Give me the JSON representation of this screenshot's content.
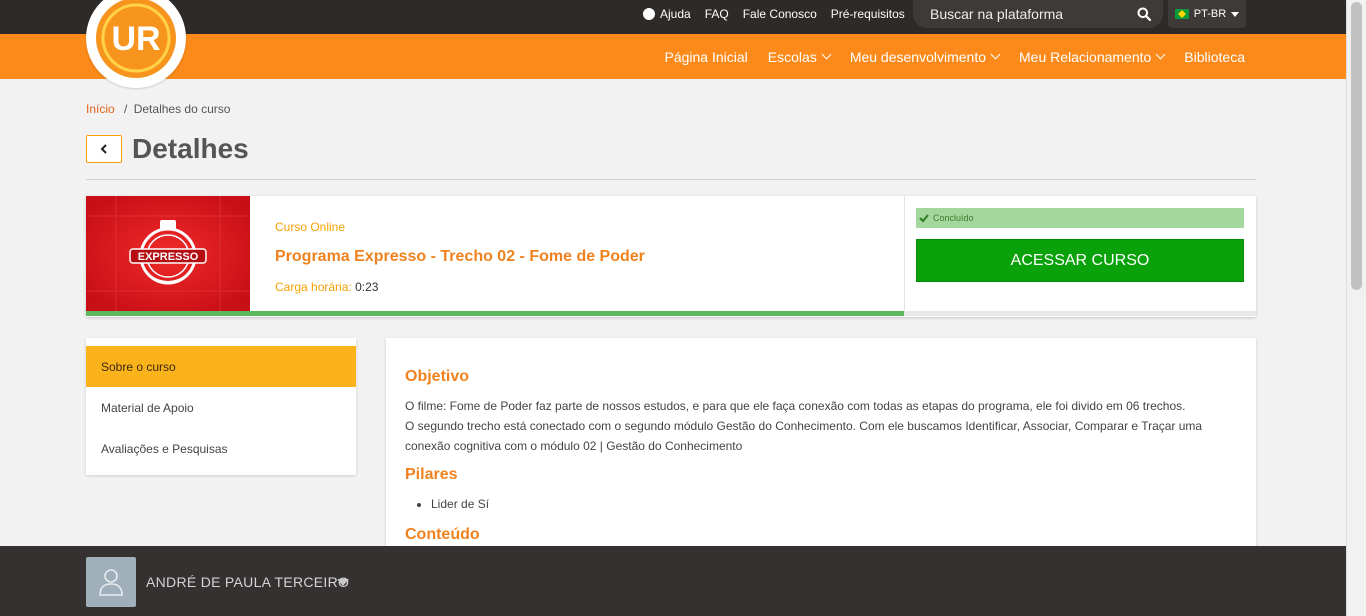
{
  "topbar": {
    "links": [
      "Ajuda",
      "FAQ",
      "Fale Conosco",
      "Pré-requisitos"
    ],
    "search_placeholder": "Buscar na plataforma",
    "language": "PT-BR"
  },
  "logo": {
    "text": "UR"
  },
  "nav": {
    "items": [
      {
        "label": "Página Inicial"
      },
      {
        "label": "Escolas"
      },
      {
        "label": "Meu desenvolvimento"
      },
      {
        "label": "Meu Relacionamento"
      },
      {
        "label": "Biblioteca"
      }
    ]
  },
  "breadcrumb": {
    "home": "Início",
    "separator": "/",
    "current": "Detalhes do curso"
  },
  "page": {
    "title": "Detalhes"
  },
  "course": {
    "type": "Curso Online",
    "title": "Programa Expresso - Trecho 02 - Fome de Poder",
    "workload_label": "Carga horária:",
    "workload_value": "0:23",
    "status": "Concluído",
    "access_button": "ACESSAR CURSO",
    "thumbnail_text": "EXPRESSO",
    "progress": 1.0
  },
  "sidebar": {
    "items": [
      {
        "label": "Sobre o curso",
        "active": true
      },
      {
        "label": "Material de Apoio",
        "active": false
      },
      {
        "label": "Avaliações e Pesquisas",
        "active": false
      }
    ]
  },
  "content": {
    "objective_heading": "Objetivo",
    "objective_p1": "O filme: Fome de Poder faz parte de nossos estudos, e para que ele faça conexão com todas as etapas do programa, ele foi divido em 06 trechos.",
    "objective_p2": "O segundo trecho está conectado com o segundo módulo Gestão do Conhecimento. Com ele buscamos Identificar, Associar, Comparar e Traçar uma conexão cognitiva com o módulo 02 | Gestão do Conhecimento",
    "pillars_heading": "Pilares",
    "pillars": [
      "Lider de Sí"
    ],
    "content_heading": "Conteúdo"
  },
  "user": {
    "name": "ANDRÉ DE PAULA TERCEIRO"
  },
  "colors": {
    "orange": "#fb8a1a",
    "dark": "#2e2a27",
    "green_button": "#09a20a",
    "active_menu": "#fbb31b"
  }
}
